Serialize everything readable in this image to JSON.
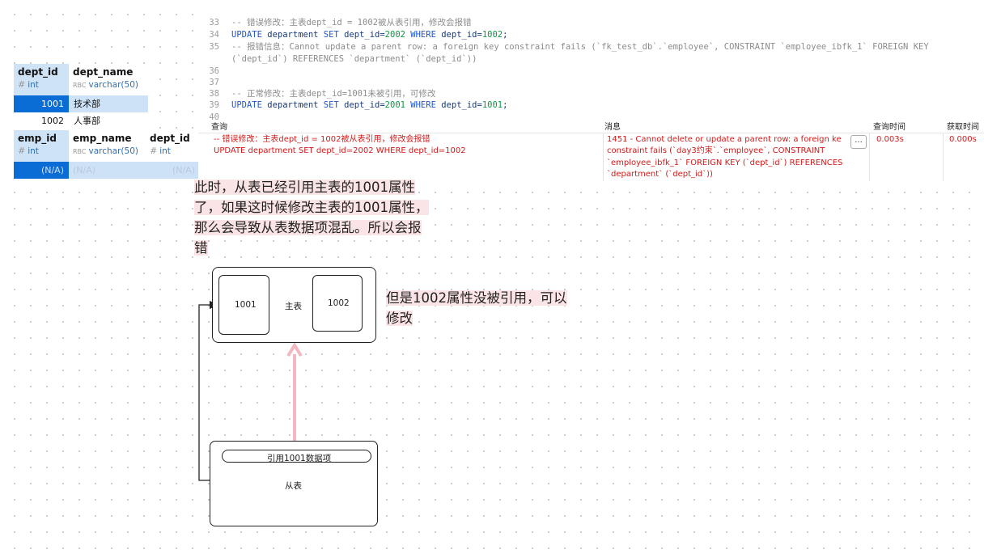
{
  "dept_table": {
    "columns": [
      {
        "name": "dept_id",
        "type": "int",
        "type_icon": "#"
      },
      {
        "name": "dept_name",
        "type": "varchar(50)",
        "type_icon": "RBC"
      }
    ],
    "rows": [
      {
        "dept_id": "1001",
        "dept_name": "技术部"
      },
      {
        "dept_id": "1002",
        "dept_name": "人事部"
      }
    ]
  },
  "emp_table": {
    "columns": [
      {
        "name": "emp_id",
        "type": "int",
        "type_icon": "#"
      },
      {
        "name": "emp_name",
        "type": "varchar(50)",
        "type_icon": "RBC"
      },
      {
        "name": "dept_id",
        "type": "int",
        "type_icon": "#"
      }
    ],
    "row": {
      "emp_id": "(N/A)",
      "emp_name": "(N/A)",
      "dept_id": "(N/A)"
    }
  },
  "editor": {
    "lines": {
      "n33": "33",
      "t33": "-- 错误修改：主表dept_id = 1002被从表引用，修改会报错",
      "n34": "34",
      "t34a": "UPDATE",
      "t34b": " department ",
      "t34c": "SET",
      "t34d": " dept_id=",
      "t34e": "2002",
      "t34f": " WHERE ",
      "t34g": "dept_id=",
      "t34h": "1002",
      "t34i": ";",
      "n35": "35",
      "t35": "-- 报错信息：Cannot update a parent row: a foreign key constraint fails (`fk_test_db`.`employee`, CONSTRAINT `employee_ibfk_1` FOREIGN KEY",
      "t35b": "(`dept_id`) REFERENCES `department` (`dept_id`))",
      "n36": "36",
      "n37": "37",
      "n38": "38",
      "t38": "-- 正常修改：主表dept_id=1001未被引用，可修改",
      "n39": "39",
      "t39a": "UPDATE",
      "t39b": " department ",
      "t39c": "SET",
      "t39d": " dept_id=",
      "t39e": "2001",
      "t39f": " WHERE ",
      "t39g": "dept_id=",
      "t39h": "1001",
      "t39i": ";",
      "n40": "40"
    }
  },
  "results": {
    "headers": {
      "query": "查询",
      "message": "消息",
      "query_time": "查询时间",
      "fetch_time": "获取时间"
    },
    "query_line1": "-- 错误修改：主表dept_id = 1002被从表引用，修改会报错",
    "query_line2": "UPDATE department SET dept_id=2002 WHERE dept_id=1002",
    "message_lines": [
      "1451 - Cannot delete or update a parent row: a foreign ke",
      "constraint fails (`day3约束`.`employee`, CONSTRAINT",
      "`employee_ibfk_1` FOREIGN KEY (`dept_id`) REFERENCES",
      "`department` (`dept_id`))"
    ],
    "more_label": "...",
    "query_time": "0.003s",
    "fetch_time": "0.000s"
  },
  "annotations": {
    "note1_lines": [
      "此时，从表已经引用主表的1001属性",
      "了，如果这时候修改主表的1001属性，",
      "那么会导致从表数据项混乱。所以会报",
      "错"
    ],
    "note2_lines": [
      "但是1002属性没被引用，可以",
      "修改"
    ]
  },
  "diagram": {
    "cell_1001": "1001",
    "main_label": "主表",
    "cell_1002": "1002",
    "ref_label": "引用1001数据项",
    "sub_label": "从表"
  },
  "colors": {
    "selected_blue": "#0a6cd5",
    "selected_light": "#cde2f7",
    "error_red": "#d21a1a",
    "keyword_blue": "#1b58c9",
    "number_green": "#0a9a43",
    "note_pink": "#fbe4e6",
    "arrow_pink": "#f4b6bf"
  }
}
